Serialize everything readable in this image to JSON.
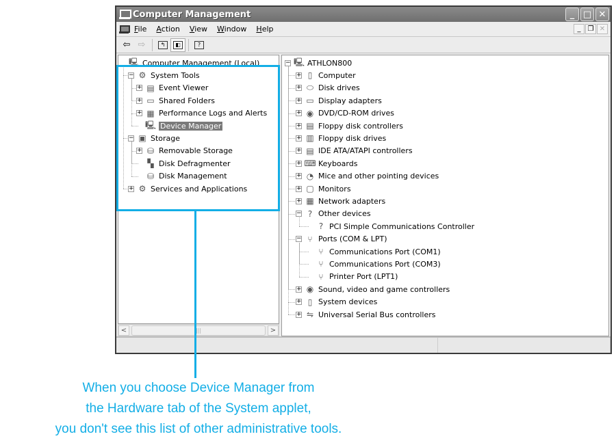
{
  "window": {
    "title": "Computer Management",
    "controls": [
      "minimize",
      "maximize",
      "close"
    ]
  },
  "menubar": {
    "items": [
      "File",
      "Action",
      "View",
      "Window",
      "Help"
    ]
  },
  "toolbar": {
    "buttons": [
      {
        "name": "back",
        "icon": "arrow-left-icon",
        "glyph": "⇦",
        "enabled": true
      },
      {
        "name": "forward",
        "icon": "arrow-right-icon",
        "glyph": "⇨",
        "enabled": false
      },
      {
        "name": "up-one-level",
        "icon": "folder-up-icon",
        "glyph": "↰",
        "enabled": true
      },
      {
        "name": "show-hide-console-tree",
        "icon": "console-tree-icon",
        "glyph": "◧",
        "enabled": true,
        "pressed": true
      },
      {
        "name": "help",
        "icon": "help-icon",
        "glyph": "?",
        "enabled": true
      }
    ]
  },
  "left_tree": [
    {
      "label": "Computer Management (Local)",
      "level": 0,
      "expander": "",
      "icon": "computer-icon",
      "glyph": "🖳"
    },
    {
      "label": "System Tools",
      "level": 1,
      "expander": "-",
      "icon": "tools-icon",
      "glyph": "⚙"
    },
    {
      "label": "Event Viewer",
      "level": 2,
      "expander": "+",
      "icon": "event-viewer-icon",
      "glyph": "▤"
    },
    {
      "label": "Shared Folders",
      "level": 2,
      "expander": "+",
      "icon": "shared-folder-icon",
      "glyph": "▭"
    },
    {
      "label": "Performance Logs and Alerts",
      "level": 2,
      "expander": "+",
      "icon": "performance-icon",
      "glyph": "▦"
    },
    {
      "label": "Device Manager",
      "level": 2,
      "expander": "",
      "icon": "device-manager-icon",
      "glyph": "🖳",
      "selected": true
    },
    {
      "label": "Storage",
      "level": 1,
      "expander": "-",
      "icon": "storage-icon",
      "glyph": "▣"
    },
    {
      "label": "Removable Storage",
      "level": 2,
      "expander": "+",
      "icon": "removable-storage-icon",
      "glyph": "⛁"
    },
    {
      "label": "Disk Defragmenter",
      "level": 2,
      "expander": "",
      "icon": "defrag-icon",
      "glyph": "▚"
    },
    {
      "label": "Disk Management",
      "level": 2,
      "expander": "",
      "icon": "disk-management-icon",
      "glyph": "⛁"
    },
    {
      "label": "Services and Applications",
      "level": 1,
      "expander": "+",
      "icon": "services-icon",
      "glyph": "⚙"
    }
  ],
  "right_tree": [
    {
      "label": "ATHLON800",
      "level": 0,
      "expander": "-",
      "icon": "computer-icon",
      "glyph": "🖳"
    },
    {
      "label": "Computer",
      "level": 1,
      "expander": "+",
      "icon": "computer-icon",
      "glyph": "▯"
    },
    {
      "label": "Disk drives",
      "level": 1,
      "expander": "+",
      "icon": "disk-drive-icon",
      "glyph": "⬭"
    },
    {
      "label": "Display adapters",
      "level": 1,
      "expander": "+",
      "icon": "display-adapter-icon",
      "glyph": "▭"
    },
    {
      "label": "DVD/CD-ROM drives",
      "level": 1,
      "expander": "+",
      "icon": "cdrom-icon",
      "glyph": "◉"
    },
    {
      "label": "Floppy disk controllers",
      "level": 1,
      "expander": "+",
      "icon": "controller-icon",
      "glyph": "▤"
    },
    {
      "label": "Floppy disk drives",
      "level": 1,
      "expander": "+",
      "icon": "floppy-icon",
      "glyph": "▥"
    },
    {
      "label": "IDE ATA/ATAPI controllers",
      "level": 1,
      "expander": "+",
      "icon": "ide-controller-icon",
      "glyph": "▤"
    },
    {
      "label": "Keyboards",
      "level": 1,
      "expander": "+",
      "icon": "keyboard-icon",
      "glyph": "⌨"
    },
    {
      "label": "Mice and other pointing devices",
      "level": 1,
      "expander": "+",
      "icon": "mouse-icon",
      "glyph": "◔"
    },
    {
      "label": "Monitors",
      "level": 1,
      "expander": "+",
      "icon": "monitor-icon",
      "glyph": "▢"
    },
    {
      "label": "Network adapters",
      "level": 1,
      "expander": "+",
      "icon": "network-adapter-icon",
      "glyph": "▦"
    },
    {
      "label": "Other devices",
      "level": 1,
      "expander": "-",
      "icon": "unknown-device-icon",
      "glyph": "?"
    },
    {
      "label": "PCI Simple Communications Controller",
      "level": 2,
      "expander": "",
      "icon": "unknown-device-warning-icon",
      "glyph": "?"
    },
    {
      "label": "Ports (COM & LPT)",
      "level": 1,
      "expander": "-",
      "icon": "port-icon",
      "glyph": "⑂"
    },
    {
      "label": "Communications Port (COM1)",
      "level": 2,
      "expander": "",
      "icon": "port-icon",
      "glyph": "⑂"
    },
    {
      "label": "Communications Port (COM3)",
      "level": 2,
      "expander": "",
      "icon": "port-warning-icon",
      "glyph": "⑂"
    },
    {
      "label": "Printer Port (LPT1)",
      "level": 2,
      "expander": "",
      "icon": "port-icon",
      "glyph": "⑂"
    },
    {
      "label": "Sound, video and game controllers",
      "level": 1,
      "expander": "+",
      "icon": "sound-icon",
      "glyph": "◉"
    },
    {
      "label": "System devices",
      "level": 1,
      "expander": "+",
      "icon": "system-device-icon",
      "glyph": "▯"
    },
    {
      "label": "Universal Serial Bus controllers",
      "level": 1,
      "expander": "+",
      "icon": "usb-icon",
      "glyph": "⇋"
    }
  ],
  "scrollbar": {
    "left_arrow": "<",
    "right_arrow": ">",
    "grip": "|||"
  },
  "callout": {
    "color": "#13aee6",
    "lines": [
      "When you choose Device Manager from",
      "the Hardware tab of the System applet,",
      "you don't see this list of other administrative tools."
    ]
  }
}
